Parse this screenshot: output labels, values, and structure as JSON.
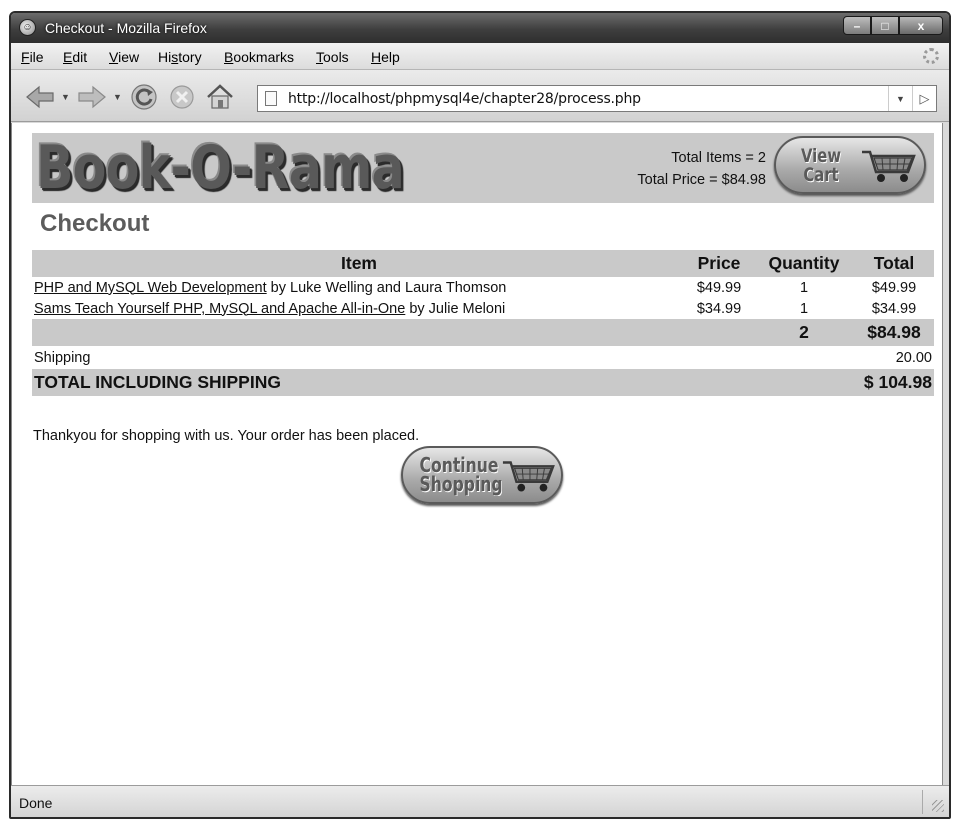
{
  "window": {
    "title": "Checkout - Mozilla Firefox",
    "buttons": {
      "minimize": "–",
      "maximize": "□",
      "close": "x"
    }
  },
  "menubar": {
    "items": [
      {
        "key": "F",
        "rest": "ile"
      },
      {
        "key": "E",
        "rest": "dit"
      },
      {
        "key": "V",
        "rest": "iew"
      },
      {
        "pre": "Hi",
        "key": "s",
        "rest": "tory"
      },
      {
        "key": "B",
        "rest": "ookmarks"
      },
      {
        "key": "T",
        "rest": "ools"
      },
      {
        "key": "H",
        "rest": "elp"
      }
    ]
  },
  "navbar": {
    "icons": {
      "back": "back-arrow-icon",
      "forward": "forward-arrow-icon",
      "reload": "reload-icon",
      "stop": "stop-icon",
      "home": "home-icon"
    },
    "url": "http://localhost/phpmysql4e/chapter28/process.php"
  },
  "site": {
    "logo": "Book-O-Rama",
    "cart_summary": {
      "items_line": "Total Items = 2",
      "price_line": "Total Price = $84.98"
    },
    "view_cart": {
      "line1": "View",
      "line2": "Cart"
    },
    "continue": {
      "line1": "Continue",
      "line2": "Shopping"
    }
  },
  "checkout": {
    "title": "Checkout",
    "columns": {
      "item": "Item",
      "price": "Price",
      "quantity": "Quantity",
      "total": "Total"
    },
    "rows": [
      {
        "title": "PHP and MySQL Web Development",
        "byline": " by Luke Welling and Laura Thomson",
        "price": "$49.99",
        "qty": "1",
        "total": "$49.99"
      },
      {
        "title": "Sams Teach Yourself PHP, MySQL and Apache All-in-One",
        "byline": " by Julie Meloni",
        "price": "$34.99",
        "qty": "1",
        "total": "$34.99"
      }
    ],
    "sum_qty": "2",
    "sum_total": "$84.98",
    "shipping_label": "Shipping",
    "shipping_value": "20.00",
    "grand_label": "TOTAL INCLUDING SHIPPING",
    "grand_value": "$ 104.98",
    "thanks": "Thankyou for shopping with us. Your order has been placed."
  },
  "statusbar": {
    "text": "Done"
  }
}
